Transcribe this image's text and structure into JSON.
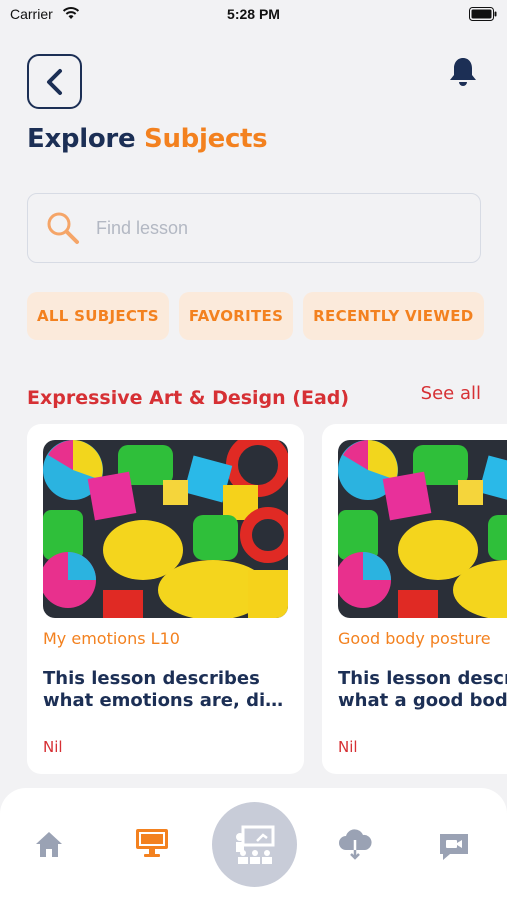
{
  "status_bar": {
    "carrier": "Carrier",
    "time": "5:28 PM"
  },
  "header": {
    "back_icon": "chevron-left-icon",
    "notification_icon": "bell-icon",
    "title_part1": "Explore",
    "title_part2": "Subjects"
  },
  "search": {
    "placeholder": "Find lesson",
    "value": ""
  },
  "filters": [
    {
      "label": "ALL SUBJECTS"
    },
    {
      "label": "FAVORITES"
    },
    {
      "label": "RECENTLY VIEWED"
    }
  ],
  "section": {
    "title": "Expressive Art & Design (Ead)",
    "see_all": "See all"
  },
  "lessons": [
    {
      "tag": "My emotions L10",
      "desc_line1": "This lesson describes",
      "desc_line2": "what emotions are, di…",
      "footer": "Nil"
    },
    {
      "tag": "Good body posture",
      "desc_line1": "This lesson describes",
      "desc_line2": "what a good body",
      "footer": "Nil"
    }
  ],
  "bottom_nav": [
    {
      "icon": "home-icon",
      "active": false
    },
    {
      "icon": "monitor-icon",
      "active": true
    },
    {
      "icon": "classroom-icon",
      "active": false
    },
    {
      "icon": "cloud-download-icon",
      "active": false
    },
    {
      "icon": "video-chat-icon",
      "active": false
    }
  ],
  "colors": {
    "navy": "#1c2f55",
    "orange": "#f3811f",
    "red": "#d63034",
    "chip_bg": "#fbeadb"
  }
}
